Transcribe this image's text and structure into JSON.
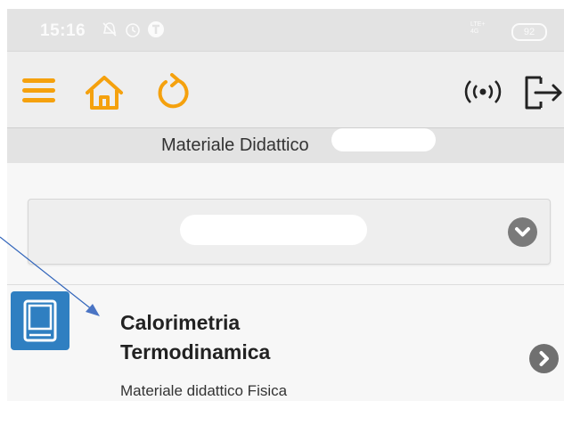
{
  "status_bar": {
    "time": "15:16",
    "icons": [
      "mute-icon",
      "alarm-icon",
      "app-notification-icon"
    ],
    "network_label": "LTE+",
    "signal": "4G",
    "battery": "92"
  },
  "toolbar": {
    "icons": [
      "menu-icon",
      "home-icon",
      "refresh-icon",
      "broadcast-icon",
      "logout-icon"
    ],
    "accent_color": "#f5a10d"
  },
  "header": {
    "title": "Materiale Didattico"
  },
  "course_select": {
    "icon": "chevron-down-icon"
  },
  "list": {
    "items": [
      {
        "title_line1": "Calorimetria",
        "title_line2": "Termodinamica",
        "subtitle": "Materiale didattico Fisica",
        "icon": "book-icon",
        "icon_color": "#2f7fc1"
      }
    ]
  }
}
